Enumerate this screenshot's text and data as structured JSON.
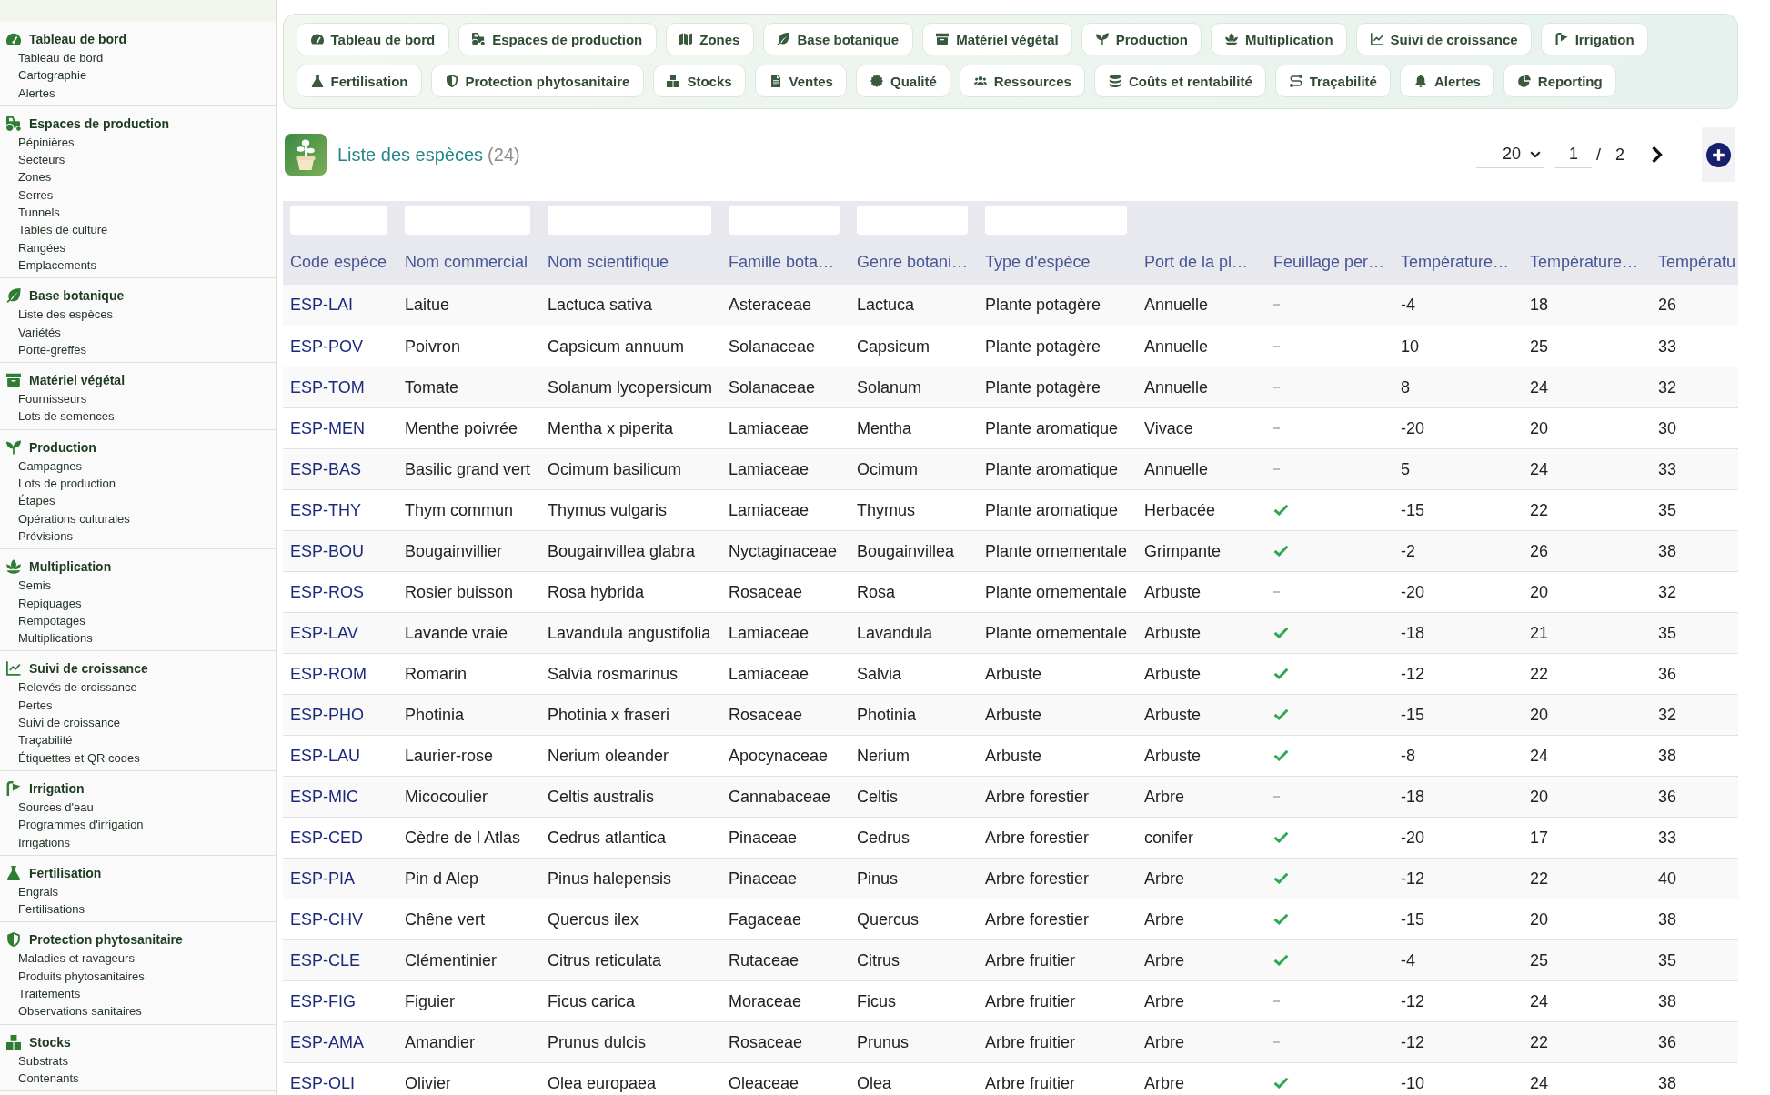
{
  "sidebar": {
    "groups": [
      {
        "title": "Tableau de bord",
        "items": [
          "Tableau de bord",
          "Cartographie",
          "Alertes"
        ]
      },
      {
        "title": "Espaces de production",
        "items": [
          "Pépinières",
          "Secteurs",
          "Zones",
          "Serres",
          "Tunnels",
          "Tables de culture",
          "Rangées",
          "Emplacements"
        ]
      },
      {
        "title": "Base botanique",
        "items": [
          "Liste des espèces",
          "Variétés",
          "Porte-greffes"
        ]
      },
      {
        "title": "Matériel végétal",
        "items": [
          "Fournisseurs",
          "Lots de semences"
        ]
      },
      {
        "title": "Production",
        "items": [
          "Campagnes",
          "Lots de production",
          "Étapes",
          "Opérations culturales",
          "Prévisions"
        ]
      },
      {
        "title": "Multiplication",
        "items": [
          "Semis",
          "Repiquages",
          "Rempotages",
          "Multiplications"
        ]
      },
      {
        "title": "Suivi de croissance",
        "items": [
          "Relevés de croissance",
          "Pertes",
          "Suivi de croissance",
          "Traçabilité",
          "Étiquettes et QR codes"
        ]
      },
      {
        "title": "Irrigation",
        "items": [
          "Sources d'eau",
          "Programmes d'irrigation",
          "Irrigations"
        ]
      },
      {
        "title": "Fertilisation",
        "items": [
          "Engrais",
          "Fertilisations"
        ]
      },
      {
        "title": "Protection phytosanitaire",
        "items": [
          "Maladies et ravageurs",
          "Produits phytosanitaires",
          "Traitements",
          "Observations sanitaires"
        ]
      },
      {
        "title": "Stocks",
        "items": [
          "Substrats",
          "Contenants"
        ]
      }
    ]
  },
  "nav": {
    "items": [
      "Tableau de bord",
      "Espaces de production",
      "Zones",
      "Base botanique",
      "Matériel végétal",
      "Production",
      "Multiplication",
      "Suivi de croissance",
      "Irrigation",
      "Fertilisation",
      "Protection phytosanitaire",
      "Stocks",
      "Ventes",
      "Qualité",
      "Ressources",
      "Coûts et rentabilité",
      "Traçabilité",
      "Alertes",
      "Reporting"
    ]
  },
  "header": {
    "title": "Liste des espèces",
    "count": "(24)"
  },
  "pagination": {
    "page_size": "20",
    "page": "1",
    "separator": "/",
    "page_count": "2"
  },
  "table": {
    "columns": [
      {
        "label": "Code espèce",
        "kind": "link",
        "filter": true
      },
      {
        "label": "Nom commercial",
        "kind": "text",
        "filter": true
      },
      {
        "label": "Nom scientifique",
        "kind": "text",
        "filter": true
      },
      {
        "label": "Famille bota…",
        "kind": "text",
        "filter": true
      },
      {
        "label": "Genre botani…",
        "kind": "text",
        "filter": true
      },
      {
        "label": "Type d'espèce",
        "kind": "text",
        "filter": true
      },
      {
        "label": "Port de la pl…",
        "kind": "text",
        "filter": false
      },
      {
        "label": "Feuillage per…",
        "kind": "check",
        "filter": false
      },
      {
        "label": "Température…",
        "kind": "text",
        "filter": false
      },
      {
        "label": "Température…",
        "kind": "text",
        "filter": false
      },
      {
        "label": "Températu",
        "kind": "text",
        "filter": false
      }
    ],
    "rows": [
      {
        "cells": [
          "ESP-LAI",
          "Laitue",
          "Lactuca sativa",
          "Asteraceae",
          "Lactuca",
          "Plante potagère",
          "Annuelle",
          {
            "checked": false
          },
          "-4",
          "18",
          "26"
        ]
      },
      {
        "cells": [
          "ESP-POV",
          "Poivron",
          "Capsicum annuum",
          "Solanaceae",
          "Capsicum",
          "Plante potagère",
          "Annuelle",
          {
            "checked": false
          },
          "10",
          "25",
          "33"
        ]
      },
      {
        "cells": [
          "ESP-TOM",
          "Tomate",
          "Solanum lycopersicum",
          "Solanaceae",
          "Solanum",
          "Plante potagère",
          "Annuelle",
          {
            "checked": false
          },
          "8",
          "24",
          "32"
        ]
      },
      {
        "cells": [
          "ESP-MEN",
          "Menthe poivrée",
          "Mentha x piperita",
          "Lamiaceae",
          "Mentha",
          "Plante aromatique",
          "Vivace",
          {
            "checked": false
          },
          "-20",
          "20",
          "30"
        ]
      },
      {
        "cells": [
          "ESP-BAS",
          "Basilic grand vert",
          "Ocimum basilicum",
          "Lamiaceae",
          "Ocimum",
          "Plante aromatique",
          "Annuelle",
          {
            "checked": false
          },
          "5",
          "24",
          "33"
        ]
      },
      {
        "cells": [
          "ESP-THY",
          "Thym commun",
          "Thymus vulgaris",
          "Lamiaceae",
          "Thymus",
          "Plante aromatique",
          "Herbacée",
          {
            "checked": true
          },
          "-15",
          "22",
          "35"
        ]
      },
      {
        "cells": [
          "ESP-BOU",
          "Bougainvillier",
          "Bougainvillea glabra",
          "Nyctaginaceae",
          "Bougainvillea",
          "Plante ornementale",
          "Grimpante",
          {
            "checked": true
          },
          "-2",
          "26",
          "38"
        ]
      },
      {
        "cells": [
          "ESP-ROS",
          "Rosier buisson",
          "Rosa hybrida",
          "Rosaceae",
          "Rosa",
          "Plante ornementale",
          "Arbuste",
          {
            "checked": false
          },
          "-20",
          "20",
          "32"
        ]
      },
      {
        "cells": [
          "ESP-LAV",
          "Lavande vraie",
          "Lavandula angustifolia",
          "Lamiaceae",
          "Lavandula",
          "Plante ornementale",
          "Arbuste",
          {
            "checked": true
          },
          "-18",
          "21",
          "35"
        ]
      },
      {
        "cells": [
          "ESP-ROM",
          "Romarin",
          "Salvia rosmarinus",
          "Lamiaceae",
          "Salvia",
          "Arbuste",
          "Arbuste",
          {
            "checked": true
          },
          "-12",
          "22",
          "36"
        ]
      },
      {
        "cells": [
          "ESP-PHO",
          "Photinia",
          "Photinia x fraseri",
          "Rosaceae",
          "Photinia",
          "Arbuste",
          "Arbuste",
          {
            "checked": true
          },
          "-15",
          "20",
          "32"
        ]
      },
      {
        "cells": [
          "ESP-LAU",
          "Laurier-rose",
          "Nerium oleander",
          "Apocynaceae",
          "Nerium",
          "Arbuste",
          "Arbuste",
          {
            "checked": true
          },
          "-8",
          "24",
          "38"
        ]
      },
      {
        "cells": [
          "ESP-MIC",
          "Micocoulier",
          "Celtis australis",
          "Cannabaceae",
          "Celtis",
          "Arbre forestier",
          "Arbre",
          {
            "checked": false
          },
          "-18",
          "20",
          "36"
        ]
      },
      {
        "cells": [
          "ESP-CED",
          "Cèdre de l Atlas",
          "Cedrus atlantica",
          "Pinaceae",
          "Cedrus",
          "Arbre forestier",
          "conifer",
          {
            "checked": true
          },
          "-20",
          "17",
          "33"
        ]
      },
      {
        "cells": [
          "ESP-PIA",
          "Pin d Alep",
          "Pinus halepensis",
          "Pinaceae",
          "Pinus",
          "Arbre forestier",
          "Arbre",
          {
            "checked": true
          },
          "-12",
          "22",
          "40"
        ]
      },
      {
        "cells": [
          "ESP-CHV",
          "Chêne vert",
          "Quercus ilex",
          "Fagaceae",
          "Quercus",
          "Arbre forestier",
          "Arbre",
          {
            "checked": true
          },
          "-15",
          "20",
          "38"
        ]
      },
      {
        "cells": [
          "ESP-CLE",
          "Clémentinier",
          "Citrus reticulata",
          "Rutaceae",
          "Citrus",
          "Arbre fruitier",
          "Arbre",
          {
            "checked": true
          },
          "-4",
          "25",
          "35"
        ]
      },
      {
        "cells": [
          "ESP-FIG",
          "Figuier",
          "Ficus carica",
          "Moraceae",
          "Ficus",
          "Arbre fruitier",
          "Arbre",
          {
            "checked": false
          },
          "-12",
          "24",
          "38"
        ]
      },
      {
        "cells": [
          "ESP-AMA",
          "Amandier",
          "Prunus dulcis",
          "Rosaceae",
          "Prunus",
          "Arbre fruitier",
          "Arbre",
          {
            "checked": false
          },
          "-12",
          "22",
          "36"
        ]
      },
      {
        "cells": [
          "ESP-OLI",
          "Olivier",
          "Olea europaea",
          "Oleaceae",
          "Olea",
          "Arbre fruitier",
          "Arbre",
          {
            "checked": true
          },
          "-10",
          "24",
          "38"
        ]
      }
    ]
  }
}
